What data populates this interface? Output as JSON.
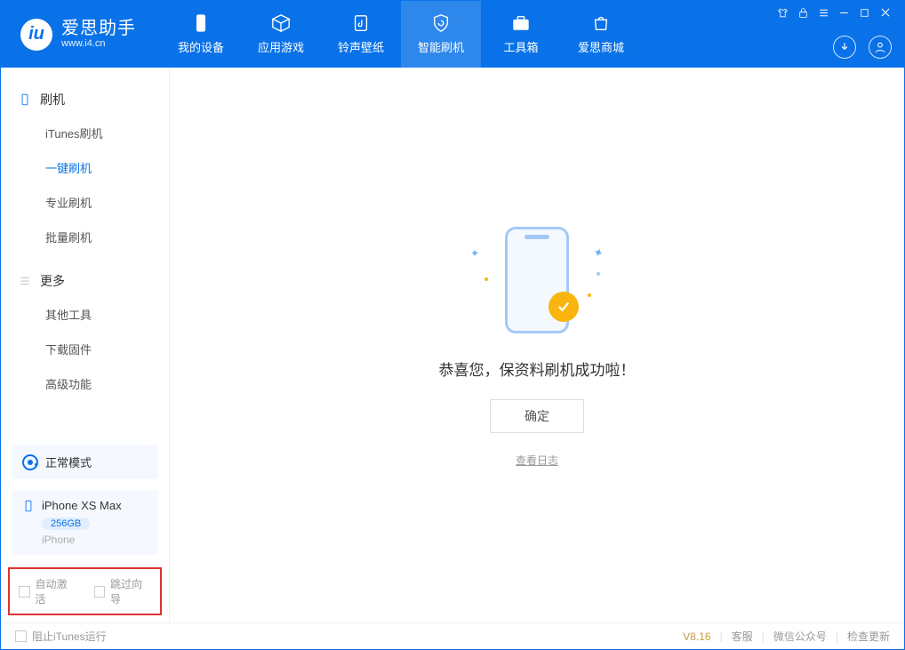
{
  "app": {
    "title": "爱思助手",
    "subtitle": "www.i4.cn"
  },
  "nav": {
    "device": "我的设备",
    "apps": "应用游戏",
    "ringtone": "铃声壁纸",
    "flash": "智能刷机",
    "toolbox": "工具箱",
    "store": "爱思商城"
  },
  "sidebar": {
    "section_flash": "刷机",
    "items_flash": {
      "itunes": "iTunes刷机",
      "onekey": "一键刷机",
      "pro": "专业刷机",
      "batch": "批量刷机"
    },
    "section_more": "更多",
    "items_more": {
      "other": "其他工具",
      "firmware": "下载固件",
      "advanced": "高级功能"
    }
  },
  "mode": {
    "label": "正常模式"
  },
  "device": {
    "name": "iPhone XS Max",
    "storage": "256GB",
    "type": "iPhone"
  },
  "options": {
    "auto_activate": "自动激活",
    "skip_guide": "跳过向导"
  },
  "main": {
    "success_text": "恭喜您，保资料刷机成功啦！",
    "ok_button": "确定",
    "view_log": "查看日志"
  },
  "footer": {
    "block_itunes": "阻止iTunes运行",
    "version": "V8.16",
    "support": "客服",
    "wechat": "微信公众号",
    "update": "检查更新"
  }
}
